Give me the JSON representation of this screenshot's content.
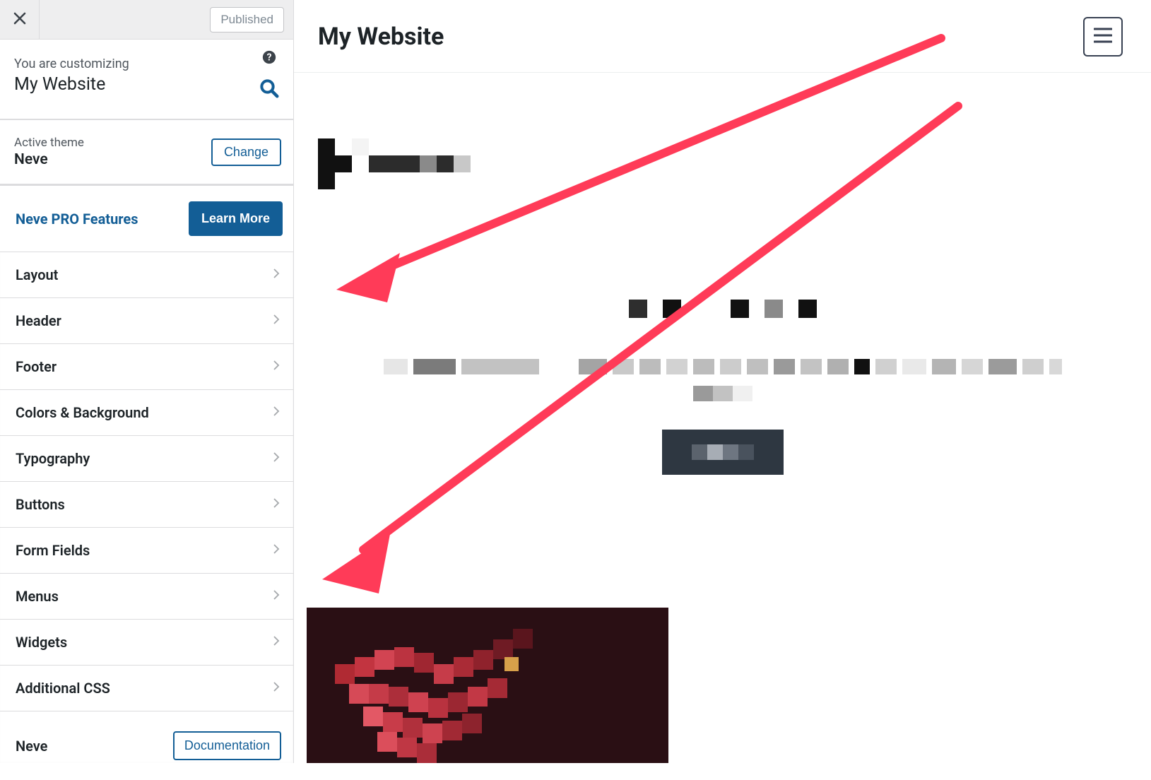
{
  "sidebar": {
    "publish_label": "Published",
    "customizing_small": "You are customizing",
    "customizing_title": "My Website",
    "active_theme_label": "Active theme",
    "active_theme_name": "Neve",
    "change_label": "Change",
    "pro_label": "Neve PRO Features",
    "learn_more_label": "Learn More",
    "items": [
      {
        "label": "Layout"
      },
      {
        "label": "Header"
      },
      {
        "label": "Footer"
      },
      {
        "label": "Colors & Background"
      },
      {
        "label": "Typography"
      },
      {
        "label": "Buttons"
      },
      {
        "label": "Form Fields"
      },
      {
        "label": "Menus"
      },
      {
        "label": "Widgets"
      },
      {
        "label": "Additional CSS"
      }
    ],
    "doc_row_label": "Neve",
    "doc_button_label": "Documentation"
  },
  "preview": {
    "site_title": "My Website"
  },
  "colors": {
    "accent": "#135e96",
    "arrow": "#ff3b58"
  }
}
